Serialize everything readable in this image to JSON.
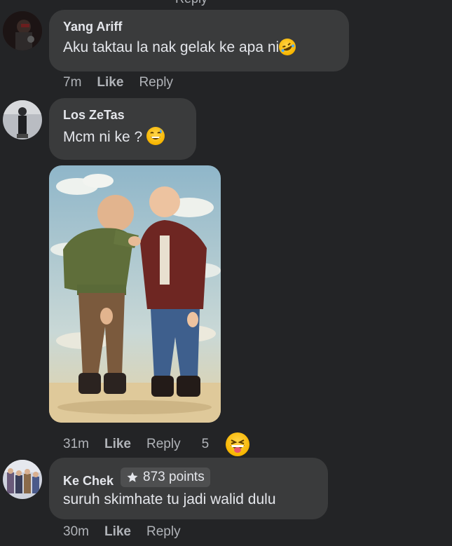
{
  "top_cutoff": "Reply",
  "comments": [
    {
      "author": "Yang Ariff",
      "text": "Aku taktau la nak gelak ke apa ni",
      "emoji": "rolling-on-floor-laughing",
      "time": "7m",
      "like": "Like",
      "reply": "Reply"
    },
    {
      "author": "Los ZeTas",
      "text": "Mcm ni ke ?",
      "emoji": "grinning-sweat",
      "time": "31m",
      "like": "Like",
      "reply": "Reply",
      "reaction_count": "5",
      "reaction_emoji": "squinting-tongue"
    },
    {
      "author": "Ke Chek",
      "badge": "873 points",
      "text": "suruh skimhate tu jadi walid dulu",
      "time": "30m",
      "like": "Like",
      "reply": "Reply"
    }
  ]
}
